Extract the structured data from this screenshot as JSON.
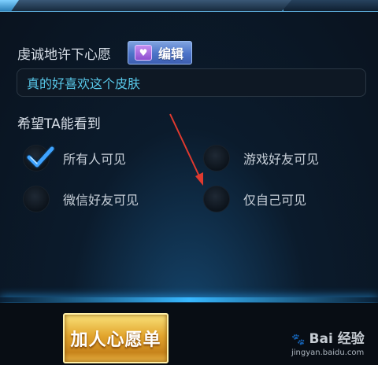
{
  "wish": {
    "label": "虔诚地许下心愿",
    "edit_button_label": "编辑",
    "input_value": "真的好喜欢这个皮肤"
  },
  "visibility": {
    "label": "希望TA能看到",
    "options": [
      {
        "label": "所有人可见",
        "selected": true
      },
      {
        "label": "游戏好友可见",
        "selected": false
      },
      {
        "label": "微信好友可见",
        "selected": false
      },
      {
        "label": "仅自己可见",
        "selected": false
      }
    ]
  },
  "actions": {
    "join_wishlist_label": "加人心愿单"
  },
  "watermark": {
    "brand": "Bai 经验",
    "url": "jingyan.baidu.com"
  },
  "colors": {
    "accent_blue": "#38b8ff",
    "wish_text": "#58c7e8",
    "gold_button": "#e2a52d",
    "edit_button": "#4c73c8",
    "annotation_arrow": "#e03a2f"
  },
  "icons": {
    "edit": "heart-icon",
    "selected": "check-icon"
  }
}
